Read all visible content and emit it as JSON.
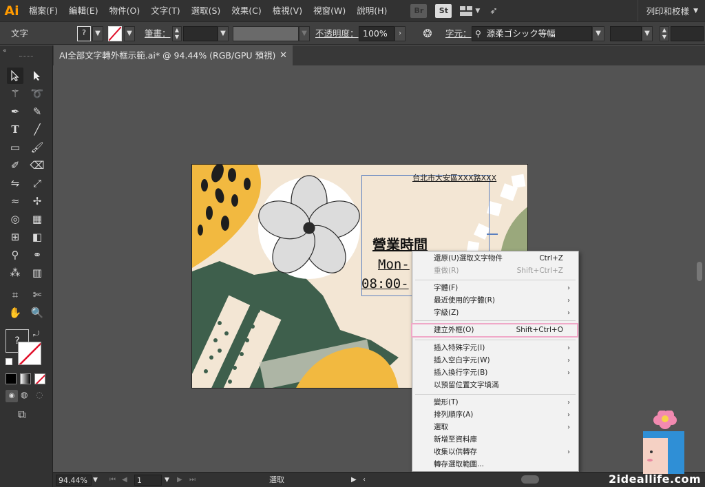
{
  "app": {
    "logo": "Ai"
  },
  "menubar": {
    "items": [
      "檔案(F)",
      "編輯(E)",
      "物件(O)",
      "文字(T)",
      "選取(S)",
      "效果(C)",
      "檢視(V)",
      "視窗(W)",
      "說明(H)"
    ],
    "bridge_btn": "Br",
    "stock_btn": "St",
    "workspace_label": "列印和校樣"
  },
  "controlbar": {
    "object_type": "文字",
    "stroke_label": "筆畫：",
    "opacity_label": "不透明度：",
    "opacity_value": "100%",
    "char_label": "字元：",
    "font_value": "源柔ゴシック等幅"
  },
  "tab": {
    "title": "AI全部文字轉外框示範.ai* @ 94.44% (RGB/GPU 預視)",
    "close": "✕"
  },
  "toolbar": {
    "question_mark": "?"
  },
  "artboard": {
    "address": "台北市大安區XXX路XXX",
    "heading": "營業時間",
    "line1": "Mon-",
    "line2": "08:00-"
  },
  "statusbar": {
    "zoom": "94.44%",
    "page": "1",
    "selection_label": "選取"
  },
  "context_menu": {
    "items": [
      {
        "label": "還原(U)選取文字物件",
        "shortcut": "Ctrl+Z",
        "disabled": false
      },
      {
        "label": "重做(R)",
        "shortcut": "Shift+Ctrl+Z",
        "disabled": true
      },
      {
        "label": "字體(F)",
        "submenu": true
      },
      {
        "label": "最近使用的字體(R)",
        "submenu": true
      },
      {
        "label": "字級(Z)",
        "submenu": true
      },
      {
        "label": "建立外框(O)",
        "shortcut": "Shift+Ctrl+O",
        "highlighted": true
      },
      {
        "label": "插入特殊字元(I)",
        "submenu": true
      },
      {
        "label": "插入空白字元(W)",
        "submenu": true
      },
      {
        "label": "插入換行字元(B)",
        "submenu": true
      },
      {
        "label": "以預留位置文字填滿"
      },
      {
        "label": "變形(T)",
        "submenu": true
      },
      {
        "label": "排列順序(A)",
        "submenu": true
      },
      {
        "label": "選取",
        "submenu": true
      },
      {
        "label": "新增至資料庫"
      },
      {
        "label": "收集以供轉存",
        "submenu": true
      },
      {
        "label": "轉存選取範圍..."
      }
    ]
  },
  "watermark": "2ideallife.com",
  "colors": {
    "accent_yellow": "#f2b940",
    "green_dark": "#3e5f4c",
    "highlight_pink": "#f0a8c8"
  }
}
